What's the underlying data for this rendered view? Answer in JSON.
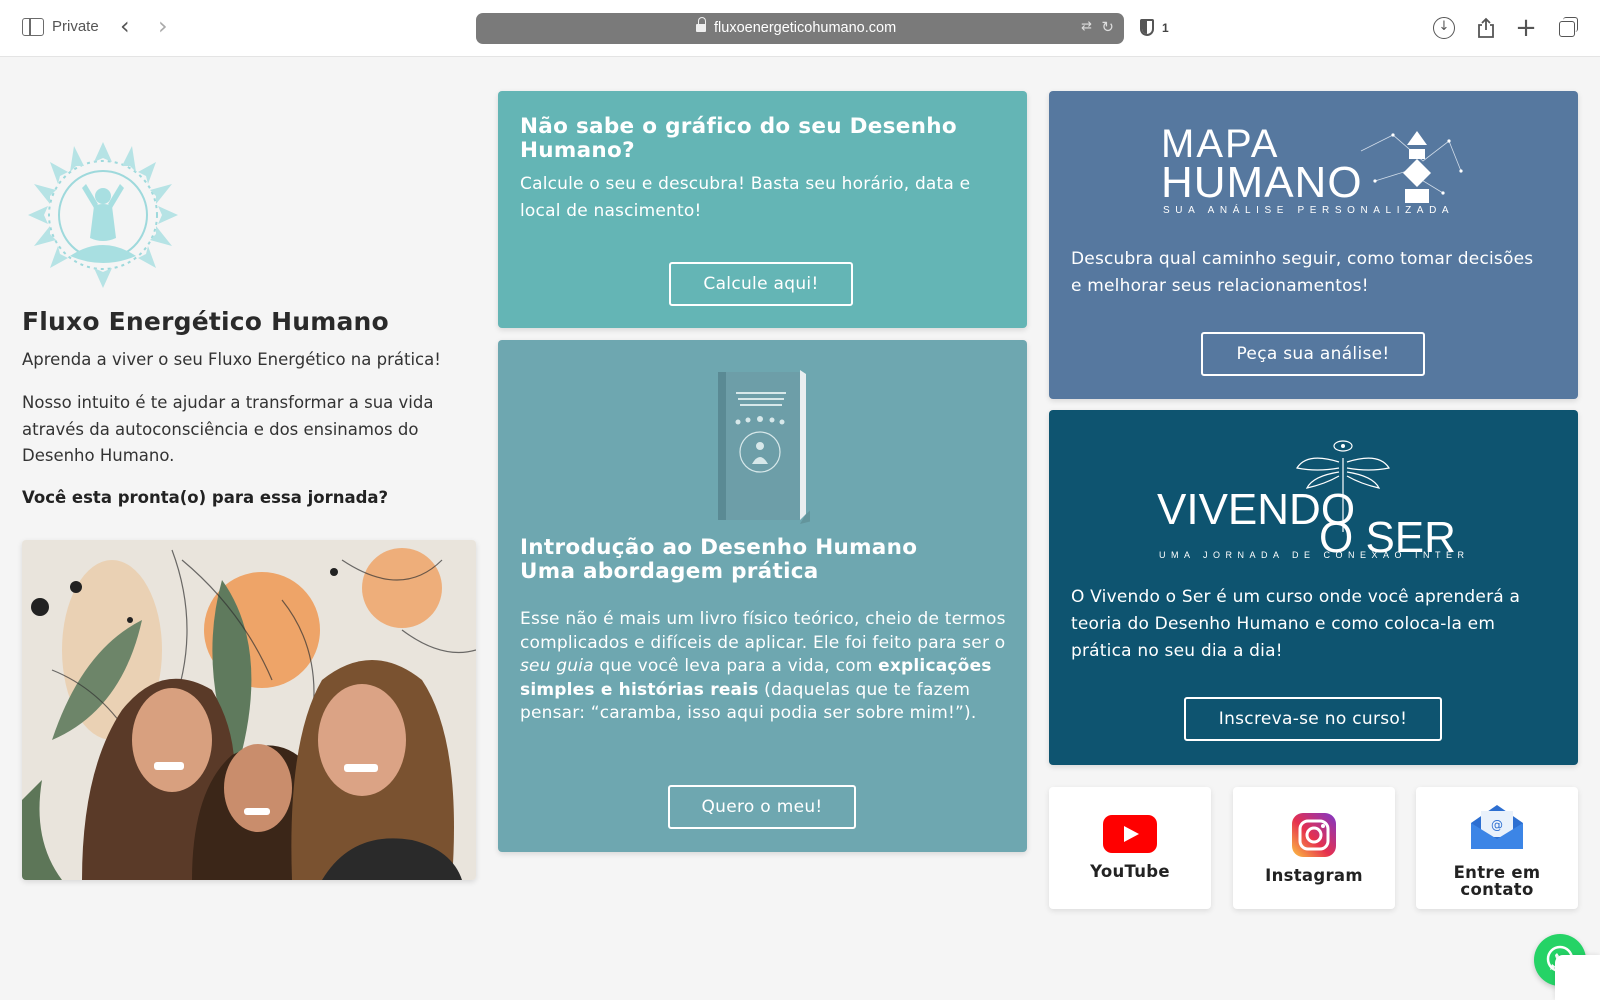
{
  "browser": {
    "private_label": "Private",
    "back_glyph": "‹",
    "forward_glyph": "›",
    "url": "fluxoenergeticohumano.com",
    "shield_count": "1",
    "icons": [
      "sidebar-icon",
      "back-icon",
      "forward-icon",
      "lock-icon",
      "translate-icon",
      "reload-icon",
      "shield-icon",
      "download-icon",
      "share-icon",
      "new-tab-icon",
      "tabs-overview-icon"
    ]
  },
  "intro": {
    "title": "Fluxo Energético Humano",
    "subtitle": "Aprenda a viver o seu Fluxo Energético na prática!",
    "description": "Nosso intuito é te ajudar a transformar a sua vida através da autoconsciência e dos ensinamos do Desenho Humano.",
    "question": "Você esta pronta(o) para essa jornada?"
  },
  "calc_card": {
    "title": "Não sabe o gráfico do seu Desenho Humano?",
    "text": "Calcule o seu e descubra! Basta seu horário, data e local de nascimento!",
    "button": "Calcule aqui!",
    "color": "#64b5b5"
  },
  "book_card": {
    "title_line1": "Introdução ao Desenho Humano",
    "title_line2": "Uma abordagem prática",
    "text_part1": "Esse não é mais um livro físico teórico, cheio de termos complicados e difíceis de aplicar. Ele foi feito para ser o ",
    "text_em": "seu guia",
    "text_part2": " que você leva para a vida, com ",
    "text_strong": "explicações simples e histórias reais",
    "text_part3": " (daquelas que te fazem pensar: “caramba, isso aqui podia ser sobre mim!”).",
    "button": "Quero o meu!",
    "color": "#6ea7b0"
  },
  "mapa_card": {
    "brand_line1": "MAPA",
    "brand_line2": "HUMANO",
    "brand_tagline": "SUA ANÁLISE PERSONALIZADA",
    "text": "Descubra qual caminho seguir, como tomar decisões e melhorar seus relacionamentos!",
    "button": "Peça sua análise!",
    "color": "#56789f"
  },
  "vivendo_card": {
    "brand_line1": "VIVENDO",
    "brand_line2": "O SER",
    "brand_tagline": "UMA JORNADA DE CONEXÃO INTERNA",
    "text": "O Vivendo o Ser é um curso onde você aprenderá a teoria do Desenho Humano e como coloca-la em prática no seu dia a dia!",
    "button": "Inscreva-se no curso!",
    "color": "#0e5470"
  },
  "social": {
    "youtube": "YouTube",
    "instagram": "Instagram",
    "contact_line1": "Entre em",
    "contact_line2": "contato"
  },
  "colors": {
    "page_bg": "#f5f5f5",
    "youtube_red": "#ff0000",
    "whatsapp_green": "#25d366",
    "logo_teal": "#9ed9dc"
  }
}
